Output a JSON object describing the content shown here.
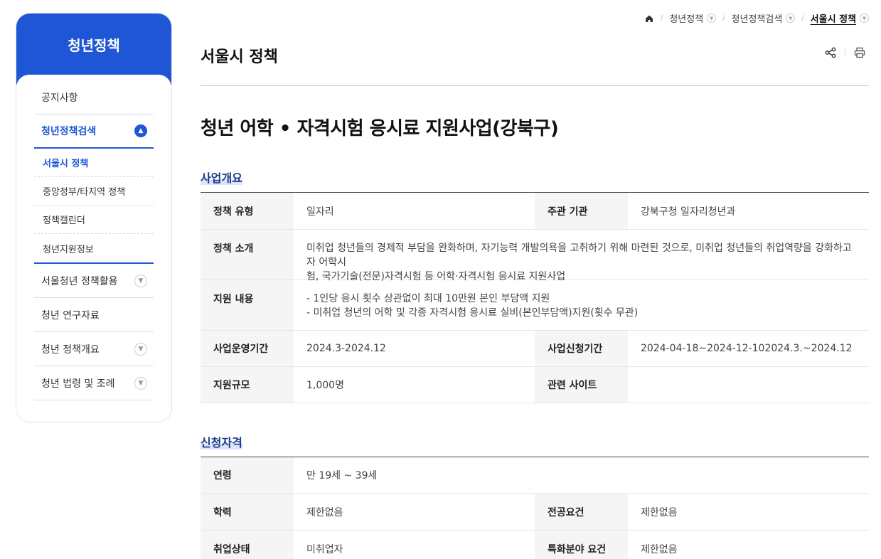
{
  "sidebar": {
    "title": "청년정책",
    "items": [
      {
        "label": "공지사항"
      },
      {
        "label": "청년정책검색"
      },
      {
        "label": "서울청년 정책활용"
      },
      {
        "label": "청년 연구자료"
      },
      {
        "label": "청년 정책개요"
      },
      {
        "label": "청년 법령 및 조례"
      }
    ],
    "sub_items": [
      {
        "label": "서울시 정책"
      },
      {
        "label": "중앙정부/타지역 정책"
      },
      {
        "label": "정책캘린더"
      },
      {
        "label": "청년지원정보"
      }
    ]
  },
  "breadcrumb": {
    "items": [
      "청년정책",
      "청년정책검색",
      "서울시 정책"
    ]
  },
  "page": {
    "title": "서울시 정책",
    "post_title": "청년 어학 • 자격시험 응시료 지원사업(강북구)"
  },
  "sections": {
    "overview": {
      "title": "사업개요",
      "policy_type_label": "정책 유형",
      "policy_type": "일자리",
      "org_label": "주관 기관",
      "org": "강북구청 일자리청년과",
      "intro_label": "정책 소개",
      "intro_line1": "미취업 청년들의 경제적 부담을 완화하며, 자기능력 개발의욕을 고취하기 위해 마련된 것으로, 미취업 청년들의 취업역량을 강화하고자 어학시",
      "intro_line2": "험, 국가기술(전문)자격시험 등 어학·자격시험 응시료 지원사업",
      "support_label": "지원 내용",
      "support_line1": "- 1인당 응시 횟수 상관없이 최대 10만원 본인 부담액 지원",
      "support_line2": "- 미취업 청년의 어학 및 각종 자격시험 응시료 실비(본인부담액)지원(횟수 무관)",
      "period_label": "사업운영기간",
      "period": "2024.3-2024.12",
      "apply_label": "사업신청기간",
      "apply": "2024-04-18~2024-12-102024.3.~2024.12",
      "scale_label": "지원규모",
      "scale": "1,000명",
      "site_label": "관련 사이트",
      "site": ""
    },
    "eligibility": {
      "title": "신청자격",
      "age_label": "연령",
      "age": "만 19세 ~ 39세",
      "edu_label": "학력",
      "edu": "제한없음",
      "major_label": "전공요건",
      "major": "제한없음",
      "job_label": "취업상태",
      "job": "미취업자",
      "special_label": "특화분야 요건",
      "special": "제한없음"
    }
  },
  "colors": {
    "brand": "#1f56d6",
    "section_title": "#1a3a8a"
  },
  "icons": {
    "home": "home-icon",
    "share": "share-icon",
    "print": "print-icon"
  }
}
